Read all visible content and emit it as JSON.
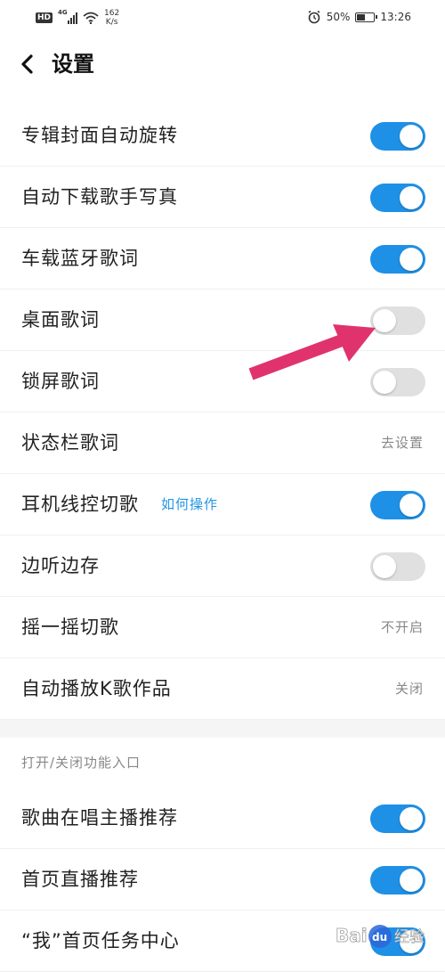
{
  "status_bar": {
    "hd_badge": "HD",
    "network_type": "4G",
    "speed_value": "162",
    "speed_unit": "K/s",
    "battery_percent": "50%",
    "battery_level": 0.5,
    "time": "13:26",
    "icons": [
      "hd-icon",
      "signal-icon",
      "wifi-icon",
      "alarm-icon",
      "battery-icon"
    ]
  },
  "header": {
    "title": "设置",
    "back_icon": "chevron-left-icon"
  },
  "colors": {
    "toggle_on": "#1e90e6",
    "toggle_off": "#e0e0e0",
    "link": "#2196e8",
    "annotation_arrow": "#e0336e"
  },
  "settings": {
    "items": [
      {
        "label": "专辑封面自动旋转",
        "type": "toggle",
        "on": true
      },
      {
        "label": "自动下载歌手写真",
        "type": "toggle",
        "on": true
      },
      {
        "label": "车载蓝牙歌词",
        "type": "toggle",
        "on": true
      },
      {
        "label": "桌面歌词",
        "type": "toggle",
        "on": false
      },
      {
        "label": "锁屏歌词",
        "type": "toggle",
        "on": false
      },
      {
        "label": "状态栏歌词",
        "type": "value",
        "value": "去设置"
      },
      {
        "label": "耳机线控切歌",
        "type": "toggle",
        "on": true,
        "link": "如何操作"
      },
      {
        "label": "边听边存",
        "type": "toggle",
        "on": false
      },
      {
        "label": "摇一摇切歌",
        "type": "value",
        "value": "不开启"
      },
      {
        "label": "自动播放K歌作品",
        "type": "value",
        "value": "关闭"
      }
    ]
  },
  "section2": {
    "title": "打开/关闭功能入口",
    "items": [
      {
        "label": "歌曲在唱主播推荐",
        "type": "toggle",
        "on": true
      },
      {
        "label": "首页直播推荐",
        "type": "toggle",
        "on": true
      },
      {
        "label": "“我”首页任务中心",
        "type": "toggle",
        "on": true
      }
    ]
  },
  "watermark": {
    "text": "Baidu经验"
  }
}
